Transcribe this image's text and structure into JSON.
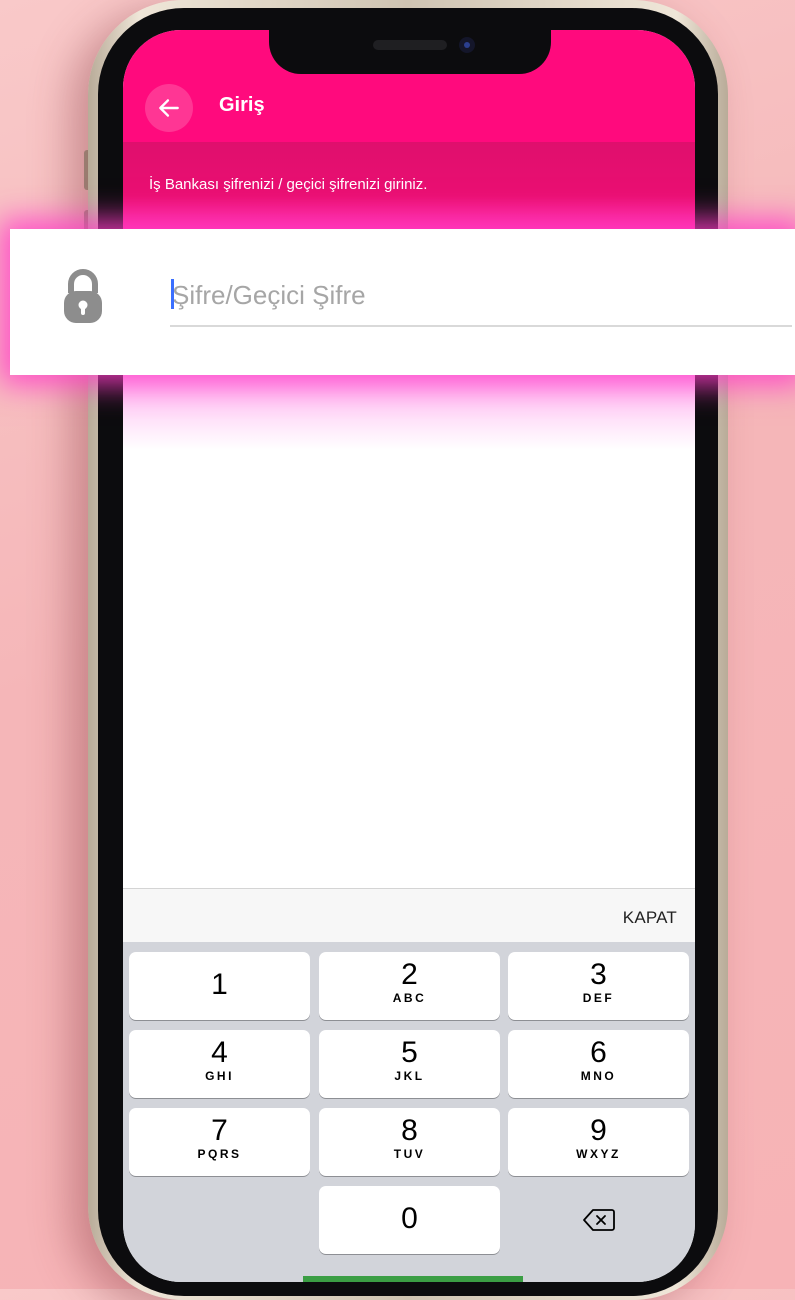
{
  "header": {
    "title": "Giriş",
    "subtitle": "İş Bankası şifrenizi / geçici şifrenizi giriniz."
  },
  "password_field": {
    "placeholder": "Şifre/Geçici Şifre",
    "value": ""
  },
  "keyboard": {
    "close_label": "KAPAT",
    "keys": [
      {
        "num": "1",
        "letters": ""
      },
      {
        "num": "2",
        "letters": "ABC"
      },
      {
        "num": "3",
        "letters": "DEF"
      },
      {
        "num": "4",
        "letters": "GHI"
      },
      {
        "num": "5",
        "letters": "JKL"
      },
      {
        "num": "6",
        "letters": "MNO"
      },
      {
        "num": "7",
        "letters": "PQRS"
      },
      {
        "num": "8",
        "letters": "TUV"
      },
      {
        "num": "9",
        "letters": "WXYZ"
      },
      {
        "num": "0",
        "letters": ""
      }
    ],
    "delete_icon": "backspace-icon"
  },
  "icons": {
    "back": "arrow-left-icon",
    "lock": "lock-icon"
  },
  "colors": {
    "brand": "#ff0a7d",
    "subheader": "#e30f70",
    "keypad": "#d2d4da",
    "caret": "#3a6fff"
  }
}
